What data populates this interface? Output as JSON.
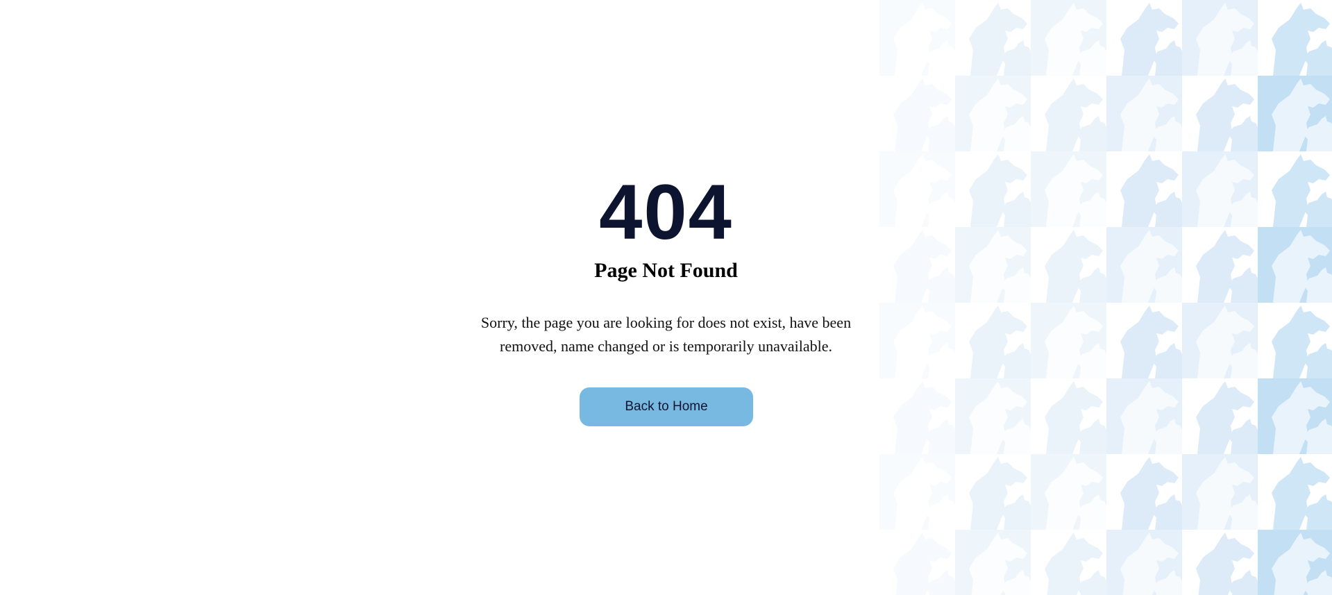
{
  "error": {
    "code": "404",
    "title": "Page Not Found",
    "message": "Sorry, the page you are looking for does not exist, have been removed, name changed or is temporarily unavailable."
  },
  "actions": {
    "home_label": "Back to Home"
  },
  "colors": {
    "code_text": "#0d1430",
    "button_bg": "#78b9e2",
    "pattern_light": "#f4f8fc",
    "pattern_mid": "#e5f0fa",
    "pattern_strong": "#c2dff3"
  },
  "decoration": {
    "pattern_icon": "horse-head-icon"
  }
}
